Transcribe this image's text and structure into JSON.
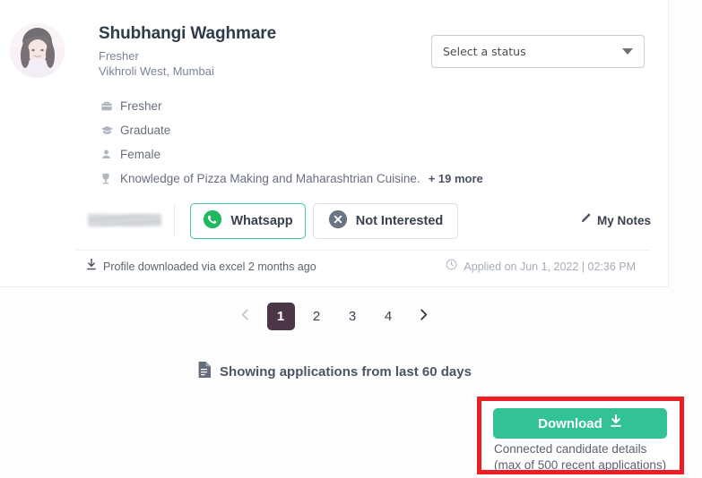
{
  "candidate": {
    "name": "Shubhangi Waghmare",
    "experience": "Fresher",
    "location": "Vikhroli West, Mumbai",
    "avatar_icon": "candidate-photo",
    "attributes": [
      {
        "icon": "briefcase-icon",
        "label": "Fresher"
      },
      {
        "icon": "graduation-cap-icon",
        "label": "Graduate"
      },
      {
        "icon": "person-icon",
        "label": "Female"
      },
      {
        "icon": "trophy-icon",
        "label": "Knowledge of Pizza Making and Maharashtrian Cuisine.",
        "more_label": "+ 19 more"
      }
    ]
  },
  "status_select": {
    "value": "Select a status",
    "caret_icon": "chevron-down-icon"
  },
  "actions": {
    "phone_masked": "",
    "whatsapp_label": "Whatsapp",
    "whatsapp_icon": "whatsapp-icon",
    "not_interested_label": "Not Interested",
    "not_interested_icon": "circle-x-icon",
    "my_notes_label": "My Notes",
    "my_notes_icon": "pencil-icon"
  },
  "card_footer": {
    "download_note": "Profile downloaded via excel 2 months ago",
    "download_note_icon": "download-icon",
    "applied_text": "Applied on Jun 1, 2022 | 02:36 PM",
    "applied_icon": "clock-icon"
  },
  "pagination": {
    "prev_icon": "chevron-left-icon",
    "next_icon": "chevron-right-icon",
    "pages": [
      "1",
      "2",
      "3",
      "4"
    ],
    "active_index": 0
  },
  "showing": {
    "icon": "document-icon",
    "text": "Showing applications from last 60 days"
  },
  "download_panel": {
    "button_label": "Download",
    "button_icon": "download-icon",
    "caption_line1": "Connected candidate details",
    "caption_line2": "(max of 500 recent applications)"
  },
  "colors": {
    "accent_green": "#33c196",
    "whatsapp_green": "#41c3a3",
    "highlight_red": "#ee1d23",
    "active_page": "#4b3648",
    "text_dark": "#2f3a4a",
    "text_muted": "#7b8594"
  }
}
